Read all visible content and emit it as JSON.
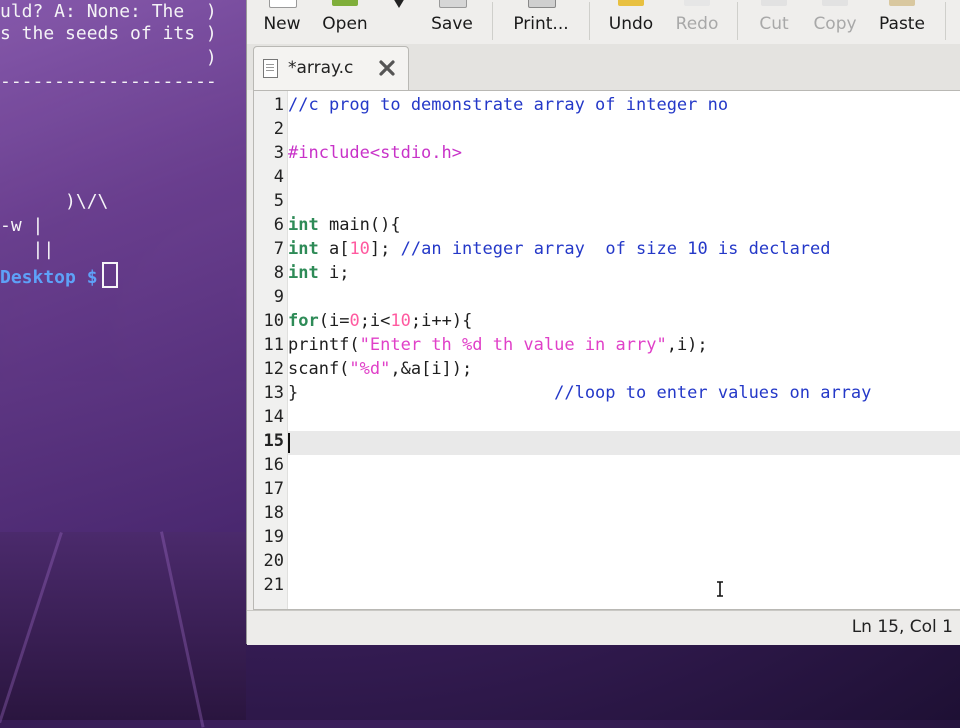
{
  "terminal": {
    "lines": [
      "uld? A: None: The  )",
      "s the seeds of its )",
      "                   )",
      "--------------------",
      "",
      "",
      "",
      "      )\\/\\",
      "-w |",
      "   ||"
    ],
    "prompt": "Desktop $"
  },
  "toolbar": {
    "new": "New",
    "open": "Open",
    "save": "Save",
    "print": "Print...",
    "undo": "Undo",
    "redo": "Redo",
    "cut": "Cut",
    "copy": "Copy",
    "paste": "Paste"
  },
  "tab": {
    "title": "*array.c"
  },
  "editor": {
    "line_numbers": [
      "1",
      "2",
      "3",
      "4",
      "5",
      "6",
      "7",
      "8",
      "9",
      "10",
      "11",
      "12",
      "13",
      "14",
      "15",
      "16",
      "17",
      "18",
      "19",
      "20",
      "21"
    ],
    "current_line": "15",
    "lines": [
      "//c prog to demonstrate array of integer no",
      "",
      "#include<stdio.h>",
      "",
      "",
      "int main(){",
      "int a[10]; //an integer array  of size 10 is declared",
      "int i;",
      "",
      "for(i=0;i<10;i++){",
      "printf(\"Enter th %d th value in arry\",i);",
      "scanf(\"%d\",&a[i]);",
      "}                         //loop to enter values on array",
      "",
      "",
      "",
      "",
      "",
      "",
      "",
      ""
    ]
  },
  "status": {
    "position": "Ln 15, Col 1"
  },
  "colors": {
    "keyword": "#2e8b57",
    "comment": "#2438c8",
    "preprocessor": "#c832c8",
    "string": "#e040c8",
    "number": "#ff5aa0"
  }
}
